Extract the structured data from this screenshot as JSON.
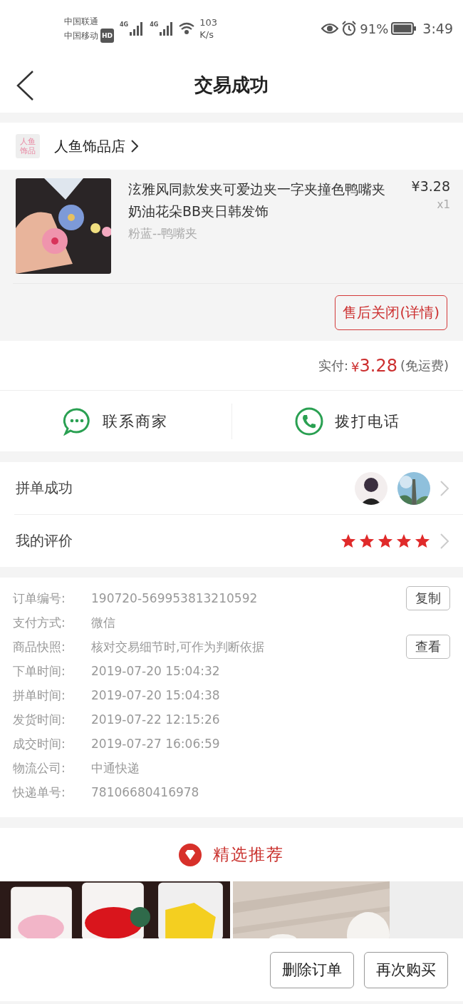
{
  "status_bar": {
    "carrier_1": "中国联通",
    "carrier_2": "中国移动",
    "hd": "HD",
    "net_1": "4G",
    "net_2": "4G",
    "speed_value": "103",
    "speed_unit": "K/s",
    "battery_percent": "91%",
    "time": "3:49"
  },
  "header": {
    "title": "交易成功"
  },
  "shop": {
    "name": "人鱼饰品店",
    "logo_text": "人鱼饰品"
  },
  "product": {
    "title": "泫雅风同款发夹可爱边夹一字夹撞色鸭嘴夹奶油花朵BB夹日韩发饰",
    "price": "¥3.28",
    "quantity": "x1",
    "variant": "粉蓝--鸭嘴夹",
    "after_sale_button": "售后关闭(详情)"
  },
  "payment": {
    "label": "实付:",
    "currency": "¥",
    "amount": "3.28",
    "note": "(免运费)"
  },
  "contact_actions": [
    {
      "kind": "chat",
      "label": "联系商家"
    },
    {
      "kind": "phone",
      "label": "拨打电话"
    }
  ],
  "group_buy": {
    "label": "拼单成功"
  },
  "review": {
    "label": "我的评价",
    "stars": 5
  },
  "order_details": [
    {
      "label": "订单编号:",
      "value": "190720-569953813210592",
      "button": "复制"
    },
    {
      "label": "支付方式:",
      "value": "微信"
    },
    {
      "label": "商品快照:",
      "value": "核对交易细节时,可作为判断依据",
      "button": "查看"
    },
    {
      "label": "下单时间:",
      "value": "2019-07-20 15:04:32"
    },
    {
      "label": "拼单时间:",
      "value": "2019-07-20 15:04:38"
    },
    {
      "label": "发货时间:",
      "value": "2019-07-22 12:15:26"
    },
    {
      "label": "成交时间:",
      "value": "2019-07-27 16:06:59"
    },
    {
      "label": "物流公司:",
      "value": "中通快递"
    },
    {
      "label": "快递单号:",
      "value": "78106680416978"
    }
  ],
  "recommend": {
    "title": "精选推荐"
  },
  "bottom_buttons": [
    "删除订单",
    "再次购买"
  ]
}
